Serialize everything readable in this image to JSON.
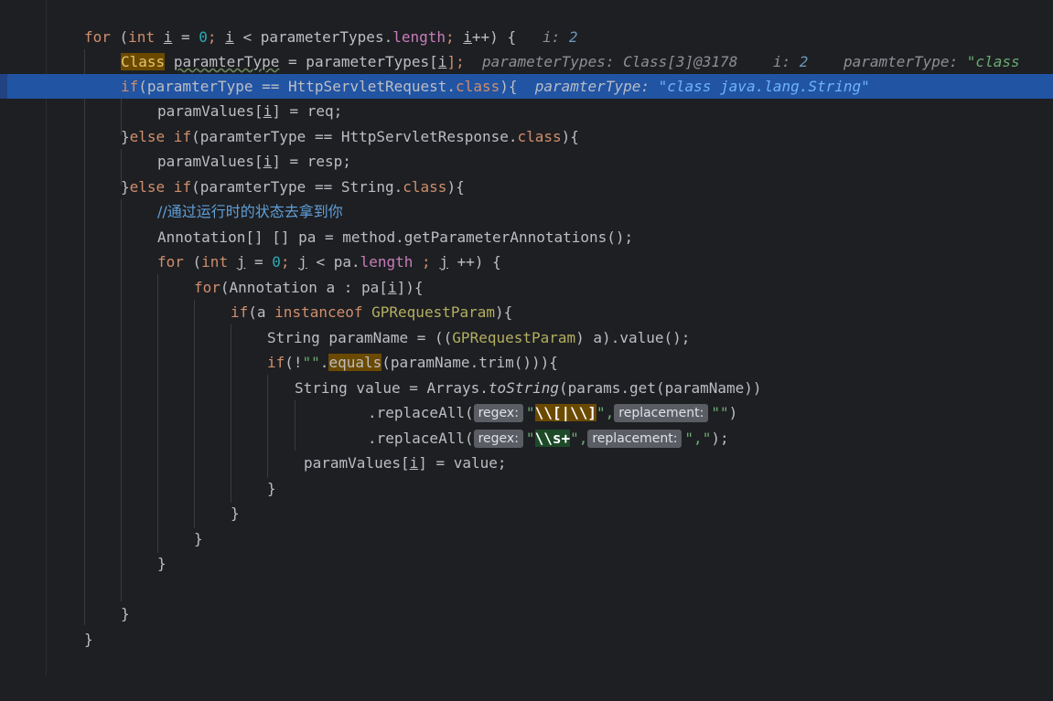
{
  "editor": {
    "lines": {
      "l1": {
        "for": "for",
        "open": " (",
        "int": "int",
        "i": "i",
        "eq": " = ",
        "zero": "0",
        "semi1": "; ",
        "i2": "i",
        "lt": " < parameterTypes.",
        "length": "length",
        "semi2": "; ",
        "i3": "i",
        "inc": "++) {",
        "hint_name": "i: ",
        "hint_val": "2"
      },
      "l2": {
        "cls": "Class",
        "sp": " ",
        "var": "paramterType",
        "rest": " = parameterTypes[",
        "i": "i",
        "end": "];",
        "hint1_name": "parameterTypes: Class[3]@3178",
        "hint2_name": "i: ",
        "hint2_val": "2",
        "hint3_name": "paramterType: ",
        "hint3_val": "\"class"
      },
      "l3": {
        "if": "if",
        "rest": "(paramterType == HttpServletRequest.",
        "class": "class",
        "end": "){",
        "hint_name": "paramterType: ",
        "hint_val": "\"class java.lang.String\""
      },
      "l4": {
        "a": "paramValues[",
        "i": "i",
        "b": "] = req;"
      },
      "l5": {
        "a": "}",
        "else": "else if",
        "b": "(paramterType == HttpServletResponse.",
        "class": "class",
        "c": "){"
      },
      "l6": {
        "a": "paramValues[",
        "i": "i",
        "b": "] = resp;"
      },
      "l7": {
        "a": "}",
        "else": "else if",
        "b": "(paramterType == String.",
        "class": "class",
        "c": "){"
      },
      "l8": {
        "slashes": "//",
        "text": "通过运行时的状态去拿到你"
      },
      "l9": {
        "a": "Annotation[] [] pa = method.getParameterAnnotations();"
      },
      "l10": {
        "for": "for",
        "a": " (",
        "int": "int",
        "sp": " ",
        "j": "j",
        "b": " = ",
        "zero": "0",
        "c": "; ",
        "j2": "j",
        "d": " < pa.",
        "length": "length",
        "e": " ; ",
        "j3": "j",
        "f": " ++) {"
      },
      "l11": {
        "for": "for",
        "a": "(Annotation a : pa[",
        "i": "i",
        "b": "]){"
      },
      "l12": {
        "if": "if",
        "a": "(a ",
        "inst": "instanceof",
        "sp": " ",
        "ann": "GPRequestParam",
        "b": "){"
      },
      "l13": {
        "a": "String paramName = ((",
        "ann": "GPRequestParam",
        "b": ") a).value();"
      },
      "l14": {
        "if": "if",
        "a": "(!",
        "str": "\"\"",
        "dot": ".",
        "equals": "equals",
        "b": "(paramName.trim())){"
      },
      "l15": {
        "a": "String value = Arrays.",
        "tostr": "toString",
        "b": "(params.get(paramName))"
      },
      "l16": {
        "a": ".replaceAll(",
        "hint1": "regex:",
        "q1": "\"",
        "rx": "\\\\[|\\\\]",
        "q2": "\",",
        "hint2": "replacement:",
        "s2": "\"\"",
        "end": ")"
      },
      "l17": {
        "a": ".replaceAll(",
        "hint1": "regex:",
        "q1": "\"",
        "rx": "\\\\s+",
        "q2": "\",",
        "hint2": "replacement:",
        "s2": "\",\"",
        "end": ");"
      },
      "l18": {
        "a": "paramValues[",
        "i": "i",
        "b": "] = value;"
      },
      "l19": {
        "a": "}"
      },
      "l20": {
        "a": "}"
      },
      "l21": {
        "a": "}"
      },
      "l22": {
        "a": "}"
      },
      "l24": {
        "a": "}"
      },
      "l25": {
        "a": "}"
      }
    },
    "colors": {
      "background": "#1e1f22",
      "execution_line": "#2154a3",
      "keyword": "#cf8e6d",
      "number": "#2aacb8",
      "string": "#6aab73",
      "field": "#c77dbb",
      "annotation": "#b3ae60"
    }
  }
}
